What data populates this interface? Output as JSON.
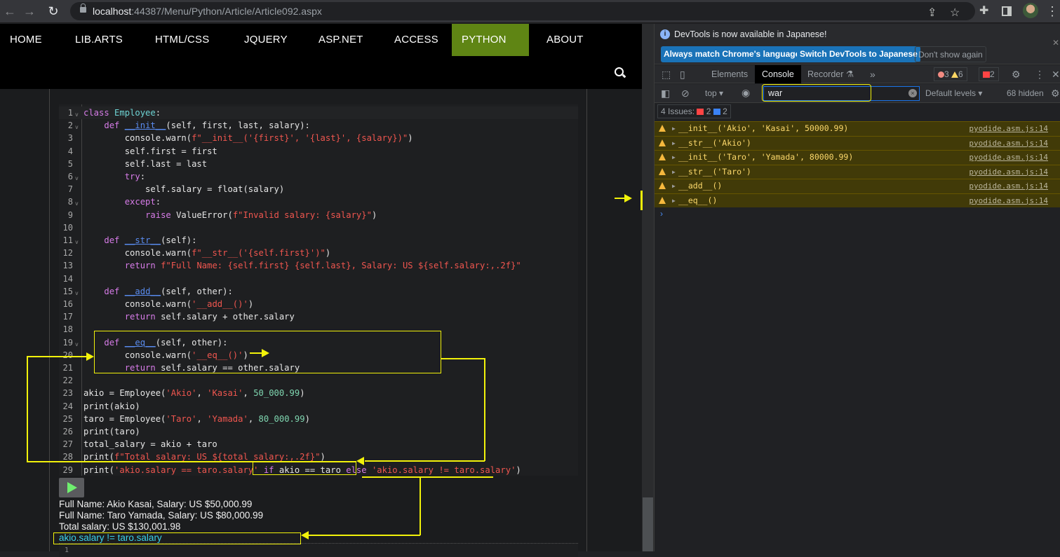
{
  "browser": {
    "url_host": "localhost",
    "url_rest": ":44387/Menu/Python/Article/Article092.aspx",
    "icons": [
      "back-icon",
      "forward-icon",
      "reload-icon",
      "lock-icon",
      "share-icon",
      "star-icon",
      "extensions-icon",
      "sidepanel-icon",
      "avatar",
      "more-icon"
    ]
  },
  "nav": {
    "items": [
      "HOME",
      "LIB.ARTS",
      "HTML/CSS",
      "JQUERY",
      "ASP.NET",
      "ACCESS",
      "PYTHON",
      "ABOUT"
    ],
    "active": "PYTHON",
    "active_color": "#5f8514"
  },
  "code": {
    "lines": [
      "class Employee:",
      "    def __init__(self, first, last, salary):",
      "        console.warn(f\"__init__('{first}', '{last}', {salary})\")",
      "        self.first = first",
      "        self.last = last",
      "        try:",
      "            self.salary = float(salary)",
      "        except:",
      "            raise ValueError(f\"Invalid salary: {salary}\")",
      "",
      "    def __str__(self):",
      "        console.warn(f\"__str__('{self.first}')\")",
      "        return f\"Full Name: {self.first} {self.last}, Salary: US ${self.salary:,.2f}\"",
      "",
      "    def __add__(self, other):",
      "        console.warn('__add__()')",
      "        return self.salary + other.salary",
      "",
      "    def __eq__(self, other):",
      "        console.warn('__eq__()')",
      "        return self.salary == other.salary",
      "",
      "akio = Employee('Akio', 'Kasai', 50_000.99)",
      "print(akio)",
      "taro = Employee('Taro', 'Yamada', 80_000.99)",
      "print(taro)",
      "total_salary = akio + taro",
      "print(f\"Total salary: US ${total_salary:,.2f}\")",
      "print('akio.salary == taro.salary' if akio == taro else 'akio.salary != taro.salary')"
    ],
    "fold_lines": [
      1,
      2,
      6,
      8,
      11,
      15,
      19
    ]
  },
  "output": {
    "lines": [
      "Full Name: Akio Kasai, Salary: US $50,000.99",
      "Full Name: Taro Yamada, Salary: US $80,000.99",
      "Total salary: US $130,001.98",
      "akio.salary != taro.salary"
    ],
    "editor2_first_line": "1"
  },
  "devtools": {
    "info_text": "DevTools is now available in Japanese!",
    "btn_match": "Always match Chrome's language",
    "btn_switch": "Switch DevTools to Japanese",
    "btn_dont": "Don't show again",
    "tabs": [
      "Elements",
      "Console",
      "Recorder"
    ],
    "active_tab": "Console",
    "more_tabs": "»",
    "errors": "3",
    "warnings": "6",
    "issues_count": "2",
    "context": "top ▾",
    "filter_value": "war",
    "levels": "Default levels ▾",
    "hidden": "68 hidden",
    "issues_label": "4 Issues:",
    "issues_red": "2",
    "issues_blue": "2",
    "messages": [
      {
        "text": "__init__('Akio', 'Kasai', 50000.99)",
        "source": "pyodide.asm.js:14"
      },
      {
        "text": "__str__('Akio')",
        "source": "pyodide.asm.js:14"
      },
      {
        "text": "__init__('Taro', 'Yamada', 80000.99)",
        "source": "pyodide.asm.js:14"
      },
      {
        "text": "__str__('Taro')",
        "source": "pyodide.asm.js:14"
      },
      {
        "text": "__add__()",
        "source": "pyodide.asm.js:14"
      },
      {
        "text": "__eq__()",
        "source": "pyodide.asm.js:14"
      }
    ]
  }
}
